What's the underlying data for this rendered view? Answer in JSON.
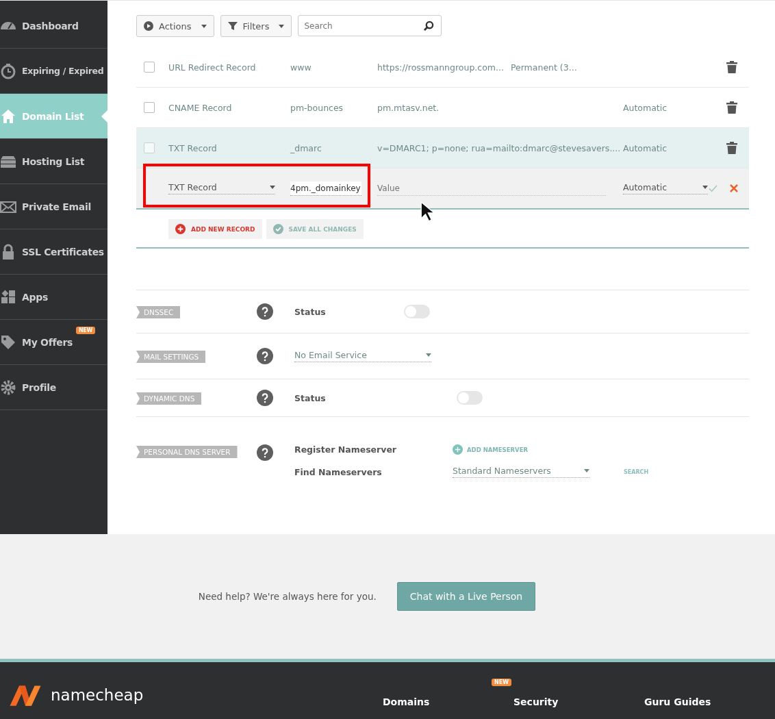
{
  "sidebar": {
    "items": [
      {
        "label": "Dashboard",
        "selected": false
      },
      {
        "label": "Expiring / Expired",
        "selected": false
      },
      {
        "label": "Domain List",
        "selected": true
      },
      {
        "label": "Hosting List",
        "selected": false
      },
      {
        "label": "Private Email",
        "selected": false
      },
      {
        "label": "SSL Certificates",
        "selected": false
      },
      {
        "label": "Apps",
        "selected": false
      },
      {
        "label": "My Offers",
        "selected": false,
        "badge": "NEW"
      },
      {
        "label": "Profile",
        "selected": false
      }
    ]
  },
  "toolbar": {
    "actions": "Actions",
    "filters": "Filters",
    "search": {
      "placeholder": "Search"
    }
  },
  "records": [
    {
      "type": "URL Redirect Record",
      "host": "www",
      "value": "https://rossmanngroup.com...",
      "redirect": "Permanent (3...",
      "checked": false,
      "selected": false
    },
    {
      "type": "CNAME Record",
      "host": "pm-bounces",
      "value": "pm.mtasv.net.",
      "ttl": "Automatic",
      "checked": false,
      "selected": false
    },
    {
      "type": "TXT Record",
      "host": "_dmarc",
      "value": "v=DMARC1; p=none; rua=mailto:dmarc@stevesavers....",
      "ttl": "Automatic",
      "checked": false,
      "selected": true
    }
  ],
  "edit_row": {
    "type": "TXT Record",
    "host": "4pm._domainkey",
    "value": {
      "placeholder": "Value"
    },
    "ttl": "Automatic"
  },
  "record_buttons": {
    "add": "ADD NEW RECORD",
    "save": "SAVE ALL CHANGES"
  },
  "settings": [
    {
      "kind": "toggle",
      "tag": "DNSSEC",
      "label": "Status",
      "on": false
    },
    {
      "kind": "select",
      "tag": "MAIL SETTINGS",
      "value": "No Email Service"
    },
    {
      "kind": "toggle",
      "tag": "DYNAMIC DNS",
      "label": "Status",
      "on": false
    },
    {
      "kind": "nameserver",
      "tag": "PERSONAL DNS SERVER",
      "register_label": "Register Nameserver",
      "add": "ADD NAMESERVER",
      "find_label": "Find Nameservers",
      "select_value": "Standard Nameservers",
      "search": "SEARCH"
    }
  ],
  "help": {
    "text": "Need help? We're always here for you.",
    "button": "Chat with a Live Person"
  },
  "footer": {
    "logo": "namecheap",
    "columns": [
      {
        "title": "Domains"
      },
      {
        "title": "Security",
        "badge": "NEW"
      },
      {
        "title": "Guru Guides"
      }
    ]
  }
}
